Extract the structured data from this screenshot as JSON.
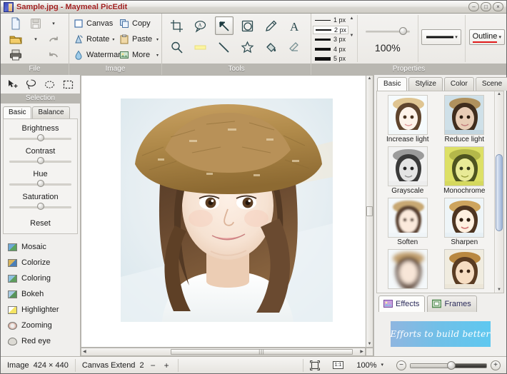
{
  "window": {
    "title": "Sample.jpg - Maymeal PicEdit",
    "app_icon": "app-icon",
    "minimize": "–",
    "maximize": "□",
    "close": "×"
  },
  "ribbon": {
    "groups": [
      {
        "label": "File"
      },
      {
        "label": "Image"
      },
      {
        "label": "Tools"
      },
      {
        "label": "Properties"
      }
    ],
    "file": {
      "icons": [
        "new-document-icon",
        "save-icon",
        "open-folder-icon",
        "redo-icon",
        "print-icon",
        "undo-icon"
      ]
    },
    "image": {
      "commands": [
        {
          "label": "Canvas",
          "icon": "canvas-icon",
          "has_caret": false
        },
        {
          "label": "Copy",
          "icon": "copy-icon",
          "has_caret": false
        },
        {
          "label": "Rotate",
          "icon": "rotate-icon",
          "has_caret": true
        },
        {
          "label": "Paste",
          "icon": "paste-icon",
          "has_caret": true
        },
        {
          "label": "Watermar",
          "icon": "watermark-icon",
          "has_caret": false
        },
        {
          "label": "More",
          "icon": "more-icon",
          "has_caret": true
        }
      ]
    },
    "tools": {
      "items": [
        {
          "name": "crop-tool",
          "selected": false
        },
        {
          "name": "callout-tool",
          "selected": false
        },
        {
          "name": "arrow-tool",
          "selected": true
        },
        {
          "name": "shape-tool",
          "selected": false
        },
        {
          "name": "pencil-tool",
          "selected": false
        },
        {
          "name": "text-tool",
          "selected": false
        },
        {
          "name": "magnifier-tool",
          "selected": false
        },
        {
          "name": "highlighter-tool",
          "selected": false
        },
        {
          "name": "line-tool",
          "selected": false
        },
        {
          "name": "star-tool",
          "selected": false
        },
        {
          "name": "fill-tool",
          "selected": false
        },
        {
          "name": "eraser-tool",
          "selected": false
        }
      ]
    },
    "properties": {
      "widths": [
        {
          "label": "1 px",
          "thickness": 1,
          "selected": false
        },
        {
          "label": "2 px",
          "thickness": 2,
          "selected": true
        },
        {
          "label": "3 px",
          "thickness": 3,
          "selected": false
        },
        {
          "label": "4 px",
          "thickness": 4,
          "selected": false
        },
        {
          "label": "5 px",
          "thickness": 5,
          "selected": false
        }
      ],
      "opacity_value": "100%",
      "line_style_label": "solid-line",
      "outline_label": "Outline"
    }
  },
  "left_panel": {
    "selection": {
      "label": "Selection",
      "tools": [
        "move-selection-icon",
        "lasso-icon",
        "ellipse-select-icon",
        "rect-select-icon"
      ]
    },
    "tabs": [
      {
        "label": "Basic",
        "active": true
      },
      {
        "label": "Balance",
        "active": false
      }
    ],
    "adjustments": [
      {
        "label": "Brightness"
      },
      {
        "label": "Contrast"
      },
      {
        "label": "Hue"
      },
      {
        "label": "Saturation"
      }
    ],
    "reset_label": "Reset",
    "effects": [
      {
        "label": "Mosaic",
        "icon": "mosaic-icon"
      },
      {
        "label": "Colorize",
        "icon": "colorize-icon"
      },
      {
        "label": "Coloring",
        "icon": "coloring-icon"
      },
      {
        "label": "Bokeh",
        "icon": "bokeh-icon"
      },
      {
        "label": "Highlighter",
        "icon": "highlighter-icon"
      },
      {
        "label": "Zooming",
        "icon": "zooming-icon"
      },
      {
        "label": "Red eye",
        "icon": "red-eye-icon"
      }
    ]
  },
  "canvas": {
    "image_alt": "portrait-of-girl-in-straw-hat",
    "hscroll_grip": "|||"
  },
  "right_panel": {
    "tabs": [
      {
        "label": "Basic",
        "active": true
      },
      {
        "label": "Stylize",
        "active": false
      },
      {
        "label": "Color",
        "active": false
      },
      {
        "label": "Scene",
        "active": false
      }
    ],
    "effects": [
      {
        "label": "Increase light",
        "kind": "increase-light"
      },
      {
        "label": "Reduce light",
        "kind": "reduce-light"
      },
      {
        "label": "Grayscale",
        "kind": "grayscale"
      },
      {
        "label": "Monochrome",
        "kind": "monochrome"
      },
      {
        "label": "Soften",
        "kind": "soften"
      },
      {
        "label": "Sharpen",
        "kind": "sharpen"
      },
      {
        "label": "",
        "kind": "blur-extra"
      },
      {
        "label": "",
        "kind": "warm-extra"
      }
    ],
    "bottom_tabs": [
      {
        "label": "Effects",
        "icon": "effects-icon",
        "active": true
      },
      {
        "label": "Frames",
        "icon": "frames-icon",
        "active": false
      }
    ],
    "ad_text": "Efforts to build better"
  },
  "status_bar": {
    "image_label": "Image",
    "image_size": "424 × 440",
    "canvas_extend_label": "Canvas Extend",
    "canvas_extend_value": "2",
    "minus": "−",
    "plus": "+",
    "fit_icon": "fit-to-window-icon",
    "actual_size_label": "1:1",
    "zoom_value": "100%",
    "zoom_caret": "▾",
    "zoom_out": "−",
    "zoom_in": "+"
  },
  "colors": {
    "title_text": "#a02020",
    "accent_red": "#e01b1b",
    "group_label_bg": "#b9b7b1",
    "panel_bg": "#f0efed"
  }
}
